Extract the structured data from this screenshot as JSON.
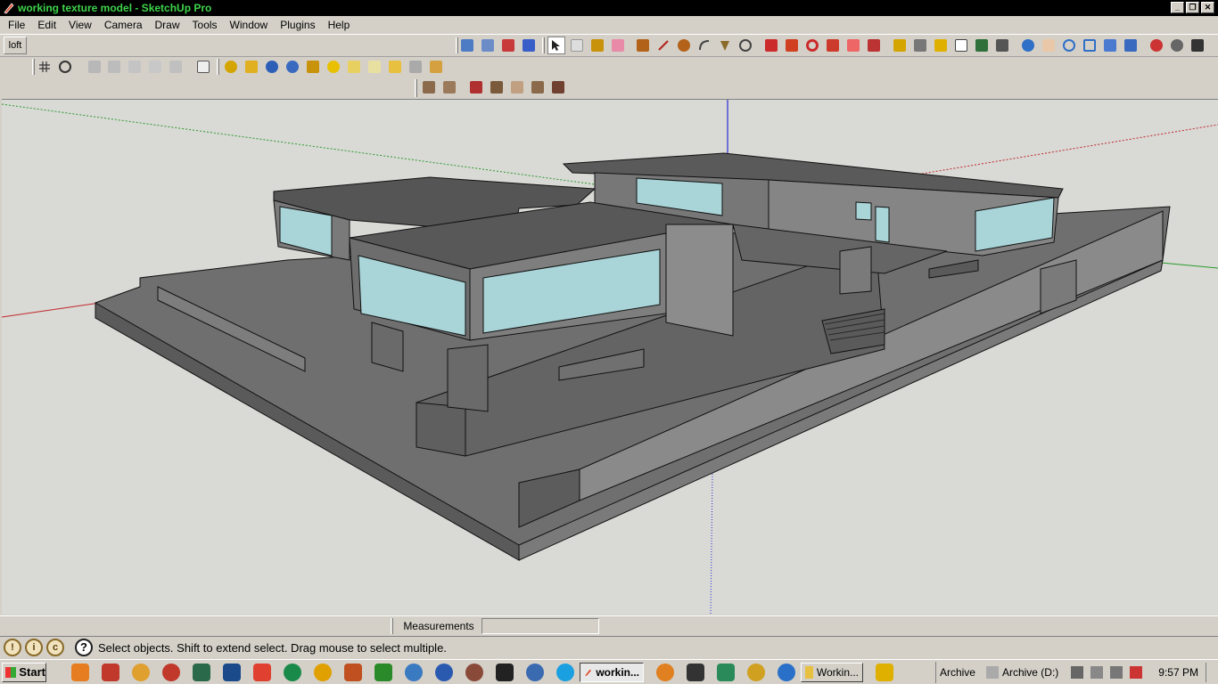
{
  "window": {
    "title": "working texture model - SketchUp Pro",
    "controls": [
      "_",
      "❐",
      "✕"
    ]
  },
  "menu": [
    "File",
    "Edit",
    "View",
    "Camera",
    "Draw",
    "Tools",
    "Window",
    "Plugins",
    "Help"
  ],
  "scene_tab": "loft",
  "toolbar_colors": {
    "style": "#4e7cc4",
    "select": "#222222",
    "draw": "#b3621a",
    "modify": "#cc2b2b",
    "construct": "#d4a400",
    "camera": "#2e6fc7",
    "walk": "#555555",
    "views": "#9a9a9a",
    "materials": "#c8920a",
    "sandbox": "#7a5a3a"
  },
  "status": {
    "measurements_label": "Measurements",
    "measurements_value": "",
    "hint": "Select objects. Shift to extend select. Drag mouse to select multiple."
  },
  "taskbar": {
    "start_label": "Start",
    "tasks": [
      "workin...",
      "Workin...",
      "Archive",
      "Archive (D:)"
    ],
    "clock": "9:57 PM"
  },
  "viewport": {
    "background": "#d9d9d6",
    "axis_colors": {
      "red": "#c0282a",
      "green": "#2a9c2a",
      "blue": "#2a2ad4"
    },
    "model_color": "#6b6b6b",
    "glass_color": "#a9d4d8"
  }
}
